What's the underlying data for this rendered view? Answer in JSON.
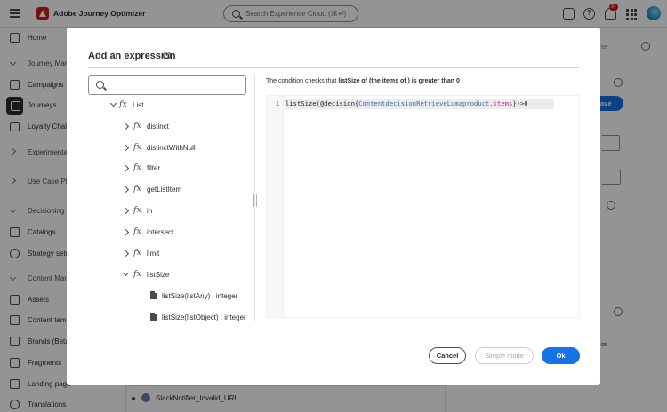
{
  "app": {
    "title": "Adobe Journey Optimizer"
  },
  "search": {
    "placeholder": "Search Experience Cloud (⌘+/)"
  },
  "notifications": {
    "badge": "9+"
  },
  "sidebar": {
    "items": [
      {
        "label": "Home"
      },
      {
        "label": "Journey Man"
      },
      {
        "label": "Campaigns"
      },
      {
        "label": "Journeys"
      },
      {
        "label": "Loyalty Chall"
      },
      {
        "label": "Experimenta"
      },
      {
        "label": "Use Case Pla"
      },
      {
        "label": "Decisioning"
      },
      {
        "label": "Catalogs"
      },
      {
        "label": "Strategy setu"
      },
      {
        "label": "Content Man"
      },
      {
        "label": "Assets"
      },
      {
        "label": "Content temp"
      },
      {
        "label": "Brands (Beta"
      },
      {
        "label": "Fragments"
      },
      {
        "label": "Landing page"
      },
      {
        "label": "Translations"
      }
    ]
  },
  "background": {
    "te_label": "te",
    "save_label": "ave",
    "or_label": "or",
    "row_text": "SlackNotifier_Invalid_URL"
  },
  "modal": {
    "title": "Add an expression",
    "condition_prefix": "The condition checks that ",
    "condition_bold": "listSize of (the items of ) is greater than 0",
    "tree": {
      "root": "List",
      "functions": [
        "distinct",
        "distinctWithNull",
        "filter",
        "getListItem",
        "in",
        "intersect",
        "limit",
        "listSize"
      ],
      "children": [
        "listSize(listAny) : integer",
        "listSize(listObject) : integer"
      ]
    },
    "editor": {
      "line_number": "1",
      "code_part1": "listSize(@decision{",
      "code_field": "ContentdecisionRetrieveLumaproduct",
      "code_dot": ".",
      "code_member": "items",
      "code_part2": "})>0"
    },
    "buttons": {
      "cancel": "Cancel",
      "simple": "Simple mode",
      "ok": "Ok"
    }
  }
}
